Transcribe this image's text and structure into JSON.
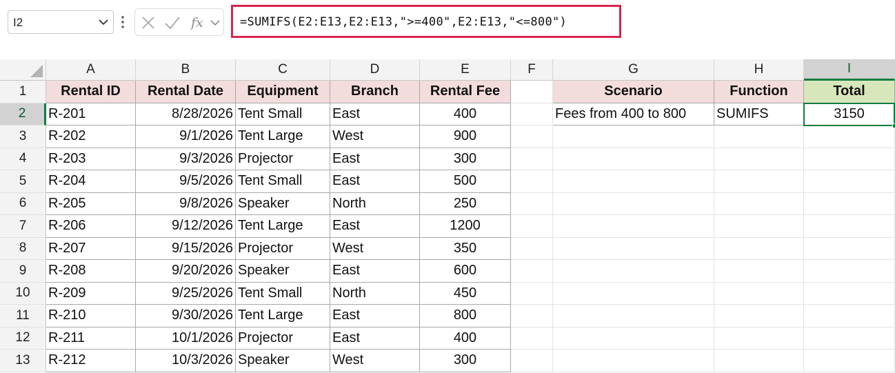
{
  "formula_bar": {
    "name_box": "I2",
    "formula": "=SUMIFS(E2:E13,E2:E13,\">=400\",E2:E13,\"<=800\")"
  },
  "columns": [
    "A",
    "B",
    "C",
    "D",
    "E",
    "F",
    "G",
    "H",
    "I"
  ],
  "rows": [
    "1",
    "2",
    "3",
    "4",
    "5",
    "6",
    "7",
    "8",
    "9",
    "10",
    "11",
    "12",
    "13"
  ],
  "table": {
    "headers": [
      "Rental ID",
      "Rental Date",
      "Equipment",
      "Branch",
      "Rental Fee"
    ],
    "rows": [
      [
        "R-201",
        "8/28/2026",
        "Tent Small",
        "East",
        "400"
      ],
      [
        "R-202",
        "9/1/2026",
        "Tent Large",
        "West",
        "900"
      ],
      [
        "R-203",
        "9/3/2026",
        "Projector",
        "East",
        "300"
      ],
      [
        "R-204",
        "9/5/2026",
        "Tent Small",
        "East",
        "500"
      ],
      [
        "R-205",
        "9/8/2026",
        "Speaker",
        "North",
        "250"
      ],
      [
        "R-206",
        "9/12/2026",
        "Tent Large",
        "East",
        "1200"
      ],
      [
        "R-207",
        "9/15/2026",
        "Projector",
        "West",
        "350"
      ],
      [
        "R-208",
        "9/20/2026",
        "Speaker",
        "East",
        "600"
      ],
      [
        "R-209",
        "9/25/2026",
        "Tent Small",
        "North",
        "450"
      ],
      [
        "R-210",
        "9/30/2026",
        "Tent Large",
        "East",
        "800"
      ],
      [
        "R-211",
        "10/1/2026",
        "Projector",
        "East",
        "400"
      ],
      [
        "R-212",
        "10/3/2026",
        "Speaker",
        "West",
        "300"
      ]
    ]
  },
  "summary": {
    "headers": [
      "Scenario",
      "Function",
      "Total"
    ],
    "rows": [
      [
        "Fees from 400 to 800",
        "SUMIFS",
        "3150"
      ]
    ]
  },
  "selection": {
    "active_cell": "I2"
  },
  "colors": {
    "header_fill": "#f3dcdc",
    "total_header_fill": "#d8e6bb",
    "selection_green": "#107c41",
    "formula_highlight": "#d6254d"
  },
  "icons": [
    "chevron-down-icon",
    "more-options-icon",
    "cancel-icon",
    "enter-check-icon",
    "fx-icon",
    "select-all-triangle-icon"
  ]
}
